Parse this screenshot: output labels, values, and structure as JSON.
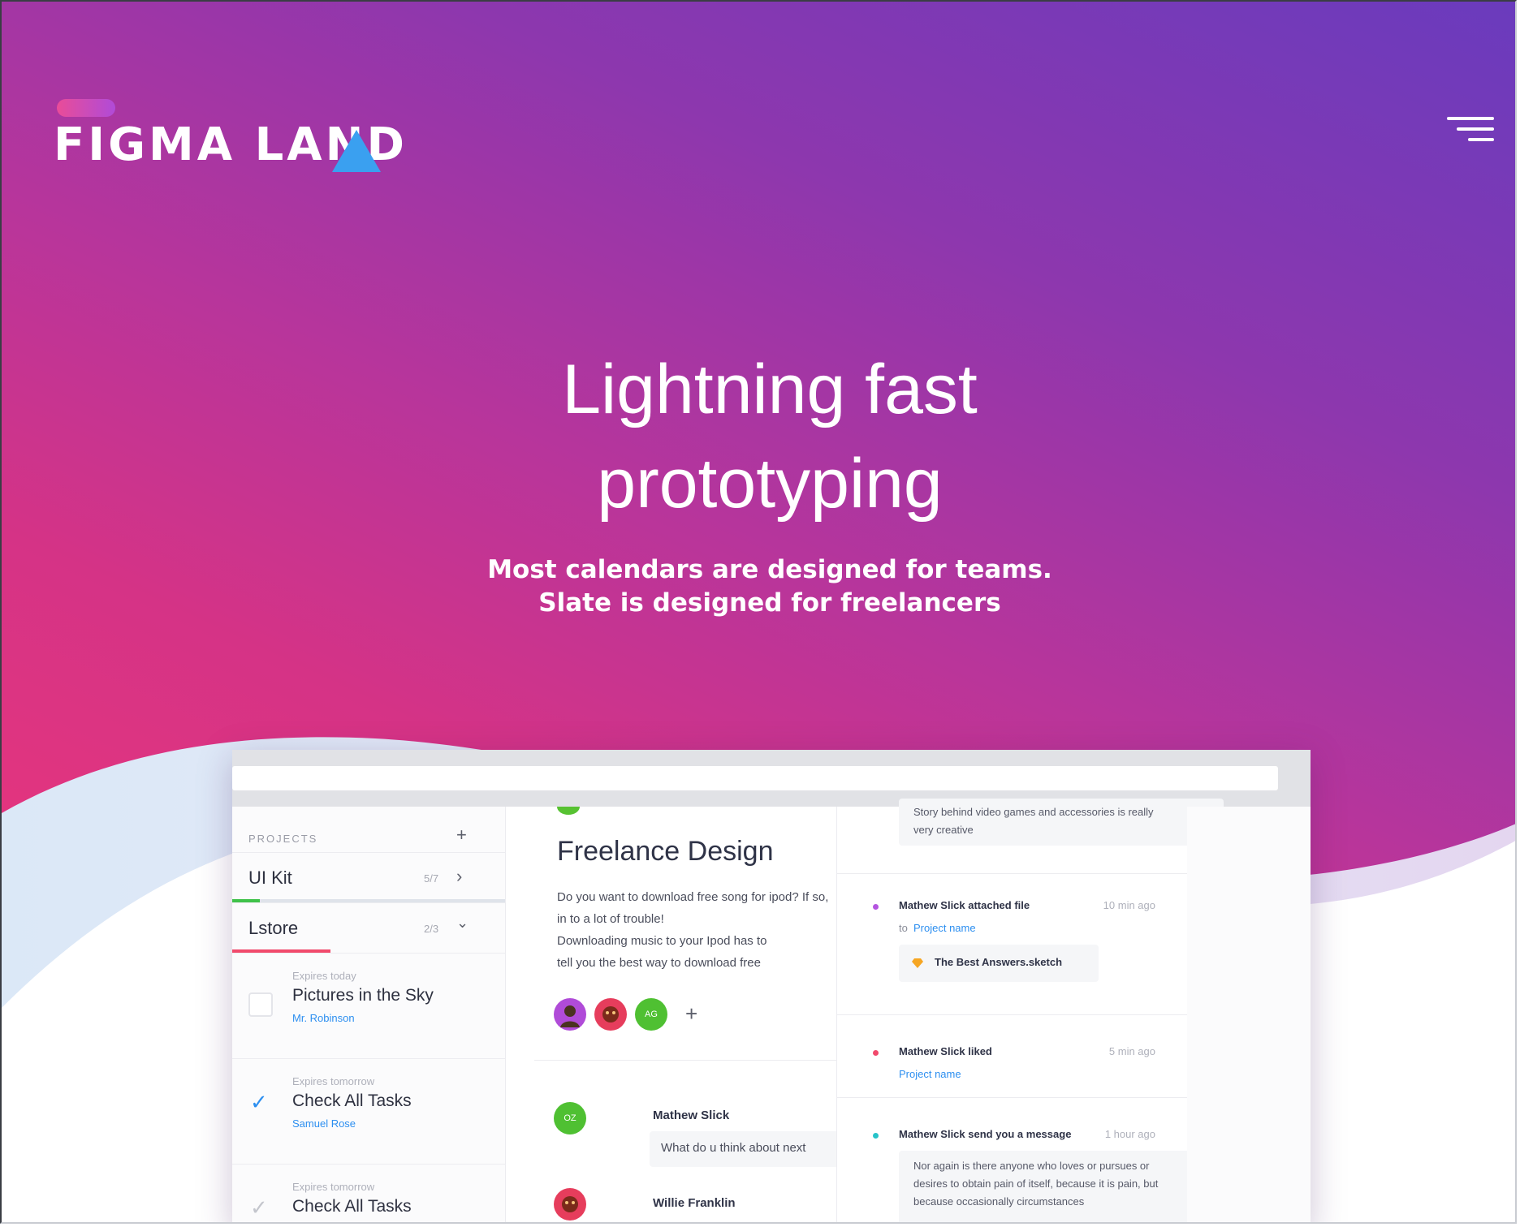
{
  "brand": {
    "logo_text": "FIGMA LAND",
    "colors": {
      "gradient_top": "#6a3bbd",
      "gradient_bottom": "#e8357b",
      "accent_blue": "#3aa0f0"
    }
  },
  "hero": {
    "title_line1": "Lightning fast",
    "title_line2": "prototyping",
    "sub_line1": "Most calendars are designed for teams.",
    "sub_line2": "Slate is designed for freelancers"
  },
  "app": {
    "projects_label": "PROJECTS",
    "projects": [
      {
        "name": "UI Kit",
        "count": "5/7",
        "progress": 0.1,
        "color": "#3fc24a"
      },
      {
        "name": "Lstore",
        "count": "2/3",
        "progress": 0.36,
        "color": "#f14a6c"
      }
    ],
    "tasks": [
      {
        "expires": "Expires today",
        "title": "Pictures in the Sky",
        "person": "Mr. Robinson",
        "done": false
      },
      {
        "expires": "Expires tomorrow",
        "title": "Check All Tasks",
        "person": "Samuel Rose",
        "done": true
      },
      {
        "expires": "Expires tomorrow",
        "title": "Check All Tasks",
        "person": "",
        "done": true
      }
    ],
    "detail": {
      "title": "Freelance Design",
      "body_lines": [
        "Do you want to download free song for ipod? If so,",
        "in to a lot of trouble!",
        "Downloading music to your Ipod has to",
        "tell you the best way to download free"
      ],
      "avatar_initials": "AG",
      "comments": [
        {
          "initials": "OZ",
          "name": "Mathew Slick",
          "text": "What do u think about next"
        },
        {
          "initials": "",
          "name": "Willie Franklin",
          "text": ""
        }
      ]
    },
    "activity": {
      "top_snippet_line1": "Story behind video games and accessories is really",
      "top_snippet_line2": "very creative",
      "items": [
        {
          "head": "Mathew Slick attached file",
          "time": "10 min ago",
          "link_prefix": "to",
          "link": "Project name",
          "file": "The Best Answers.sketch",
          "dot": "#b455e0"
        },
        {
          "head": "Mathew Slick liked",
          "time": "5 min ago",
          "link_prefix": "",
          "link": "Project name",
          "dot": "#f14a6c"
        },
        {
          "head": "Mathew Slick send you a message",
          "time": "1 hour ago",
          "dot": "#27c3c9",
          "message_lines": [
            "Nor again is there anyone who loves or pursues or",
            "desires to obtain pain of itself, because it is pain, but",
            "because occasionally circumstances"
          ]
        }
      ]
    }
  }
}
